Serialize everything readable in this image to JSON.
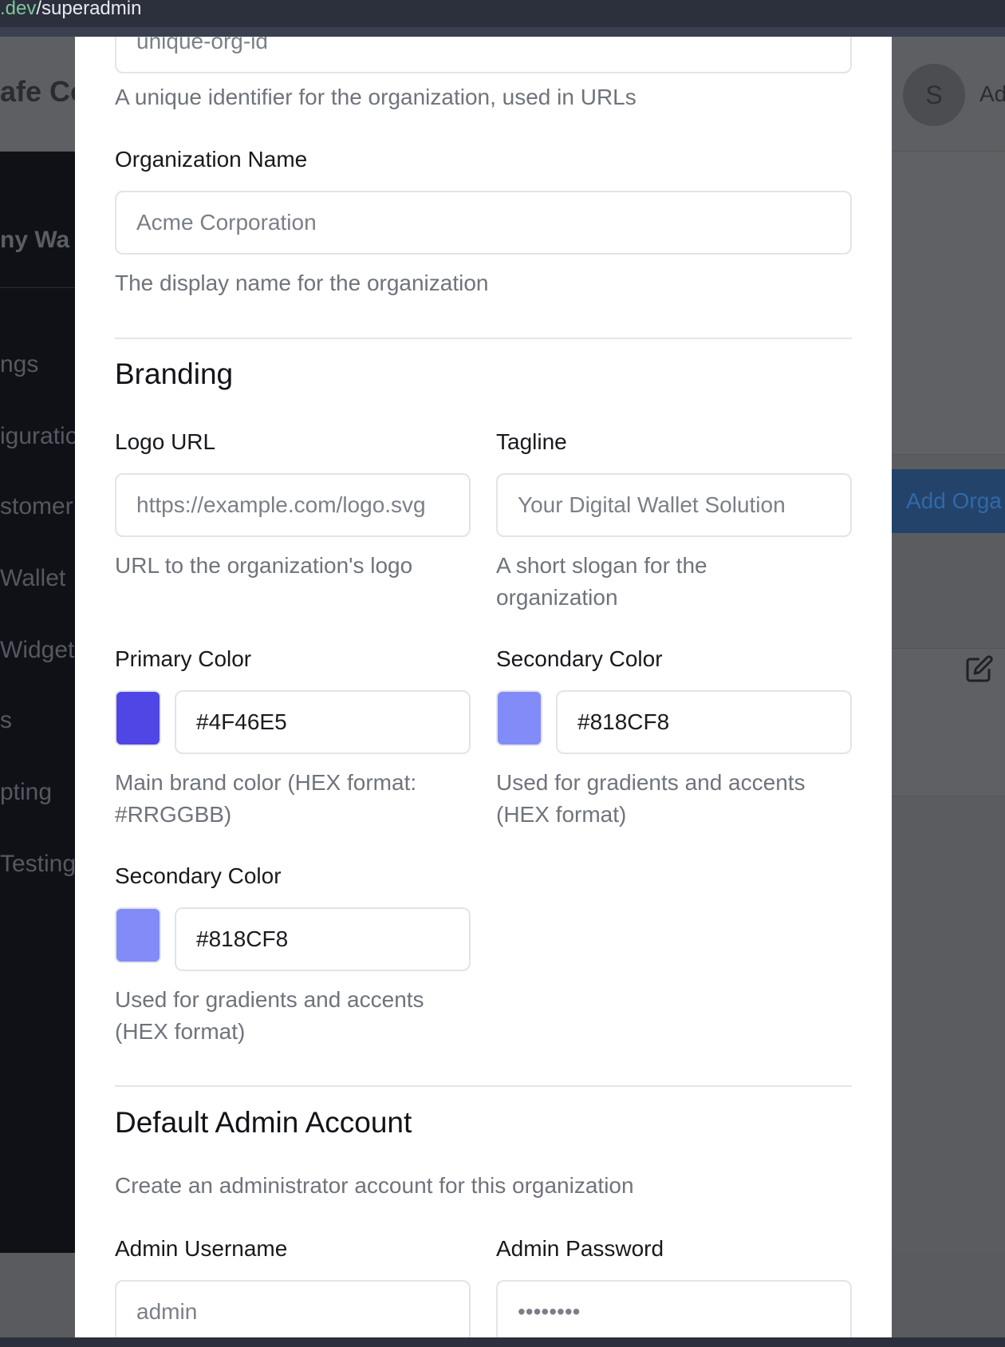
{
  "browser": {
    "url_host": ".dev",
    "url_path": "/superadmin"
  },
  "background": {
    "app_title": "afe Co",
    "brand": "ny Wa",
    "avatar_initial": "S",
    "user_label": "Ad",
    "nav_items": [
      "ngs",
      "iguratio",
      "stomer",
      "Wallet",
      "Widget",
      "s",
      "pting",
      "Testing"
    ],
    "add_button": "Add Orga",
    "row_text": "s"
  },
  "form": {
    "org_id": {
      "placeholder": "unique-org-id",
      "help": "A unique identifier for the organization, used in URLs"
    },
    "org_name": {
      "label": "Organization Name",
      "placeholder": "Acme Corporation",
      "help": "The display name for the organization"
    },
    "branding": {
      "title": "Branding",
      "logo_url": {
        "label": "Logo URL",
        "placeholder": "https://example.com/logo.svg",
        "help": "URL to the organization's logo"
      },
      "tagline": {
        "label": "Tagline",
        "placeholder": "Your Digital Wallet Solution",
        "help": "A short slogan for the organization"
      },
      "primary_color": {
        "label": "Primary Color",
        "value": "#4F46E5",
        "swatch": "#4f46e5",
        "help": "Main brand color (HEX format: #RRGGBB)"
      },
      "secondary_color": {
        "label": "Secondary Color",
        "value": "#818CF8",
        "swatch": "#818cf8",
        "help": "Used for gradients and accents (HEX format)"
      },
      "secondary_color_2": {
        "label": "Secondary Color",
        "value": "#818CF8",
        "swatch": "#818cf8",
        "help": "Used for gradients and accents (HEX format)"
      }
    },
    "admin": {
      "title": "Default Admin Account",
      "description": "Create an administrator account for this organization",
      "username": {
        "label": "Admin Username",
        "placeholder": "admin"
      },
      "password": {
        "label": "Admin Password",
        "placeholder": "••••••••"
      }
    }
  }
}
